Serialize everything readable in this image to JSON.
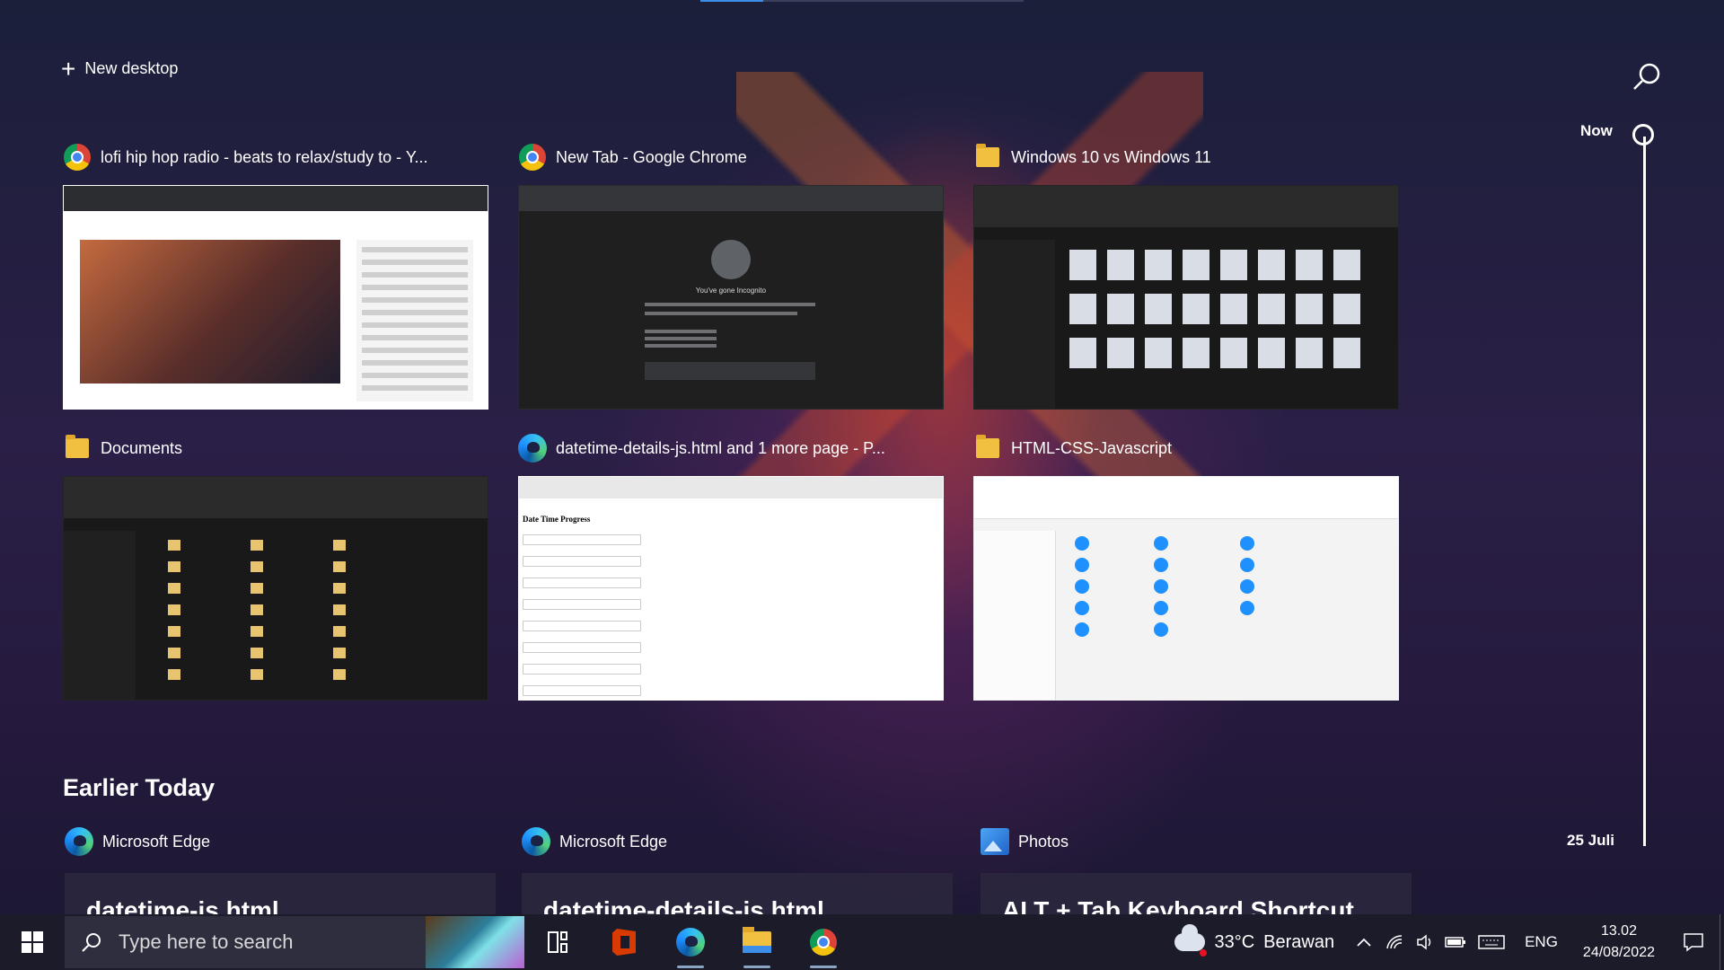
{
  "new_desktop": {
    "label": "New desktop"
  },
  "windows": [
    {
      "title": "lofi hip hop radio - beats to relax/study to - Y...",
      "icon": "chrome-icon"
    },
    {
      "title": "New Tab - Google Chrome",
      "icon": "chrome-icon"
    },
    {
      "title": "Windows 10 vs Windows 11",
      "icon": "folder-icon"
    },
    {
      "title": "Documents",
      "icon": "folder-icon"
    },
    {
      "title": "datetime-details-js.html and 1 more page - P...",
      "icon": "edge-icon"
    },
    {
      "title": "HTML-CSS-Javascript",
      "icon": "folder-icon"
    }
  ],
  "thumb_text": {
    "incognito": "You've gone Incognito",
    "page_heading": "Date Time Progress"
  },
  "earlier_today": {
    "heading": "Earlier Today",
    "items": [
      {
        "app": "Microsoft Edge",
        "title": "datetime-js.html",
        "icon": "edge-icon"
      },
      {
        "app": "Microsoft Edge",
        "title": "datetime-details-js.html",
        "icon": "edge-icon"
      },
      {
        "app": "Photos",
        "title": "ALT + Tab Keyboard Shortcut",
        "icon": "photos-icon"
      }
    ]
  },
  "timeline": {
    "now_label": "Now",
    "date_label": "25 Juli"
  },
  "taskbar": {
    "search_placeholder": "Type here to search",
    "weather": {
      "temp": "33°C",
      "condition": "Berawan"
    },
    "language": "ENG",
    "time": "13.02",
    "date": "24/08/2022",
    "pinned": [
      "task-view",
      "office",
      "edge",
      "file-explorer",
      "chrome"
    ]
  },
  "colors": {
    "accent": "#3d8ee8",
    "taskbar_bg": "#1c1b2a"
  }
}
